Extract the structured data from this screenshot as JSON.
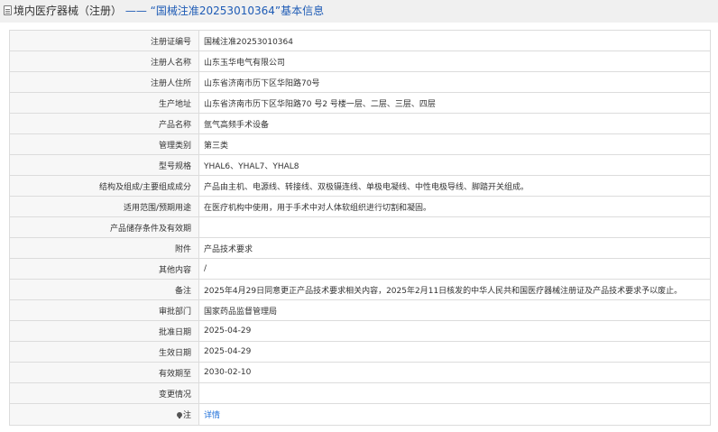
{
  "header": {
    "icon": "document-icon",
    "category": "境内医疗器械（注册）",
    "separator": "——",
    "title": "“国械注准20253010364”基本信息"
  },
  "rows": [
    {
      "label": "注册证编号",
      "value": "国械注准20253010364"
    },
    {
      "label": "注册人名称",
      "value": "山东玉华电气有限公司"
    },
    {
      "label": "注册人住所",
      "value": "山东省济南市历下区华阳路70号"
    },
    {
      "label": "生产地址",
      "value": "山东省济南市历下区华阳路70 号2 号楼一层、二层、三层、四层"
    },
    {
      "label": "产品名称",
      "value": "氩气高频手术设备"
    },
    {
      "label": "管理类别",
      "value": "第三类"
    },
    {
      "label": "型号规格",
      "value": "YHAL6、YHAL7、YHAL8"
    },
    {
      "label": "结构及组成/主要组成成分",
      "value": "产品由主机、电源线、转接线、双极镊连线、单极电凝线、中性电极导线、脚踏开关组成。"
    },
    {
      "label": "适用范围/预期用途",
      "value": "在医疗机构中使用，用于手术中对人体软组织进行切割和凝固。"
    },
    {
      "label": "产品储存条件及有效期",
      "value": ""
    },
    {
      "label": "附件",
      "value": "产品技术要求"
    },
    {
      "label": "其他内容",
      "value": "/"
    },
    {
      "label": "备注",
      "value": "2025年4月29日同意更正产品技术要求相关内容，2025年2月11日核发的中华人民共和国医疗器械注册证及产品技术要求予以废止。"
    },
    {
      "label": "审批部门",
      "value": "国家药品监督管理局"
    },
    {
      "label": "批准日期",
      "value": "2025-04-29"
    },
    {
      "label": "生效日期",
      "value": "2025-04-29"
    },
    {
      "label": "有效期至",
      "value": "2030-02-10"
    },
    {
      "label": "变更情况",
      "value": ""
    }
  ],
  "note_row": {
    "icon": "tip-icon",
    "label": "注",
    "link_text": "详情"
  }
}
